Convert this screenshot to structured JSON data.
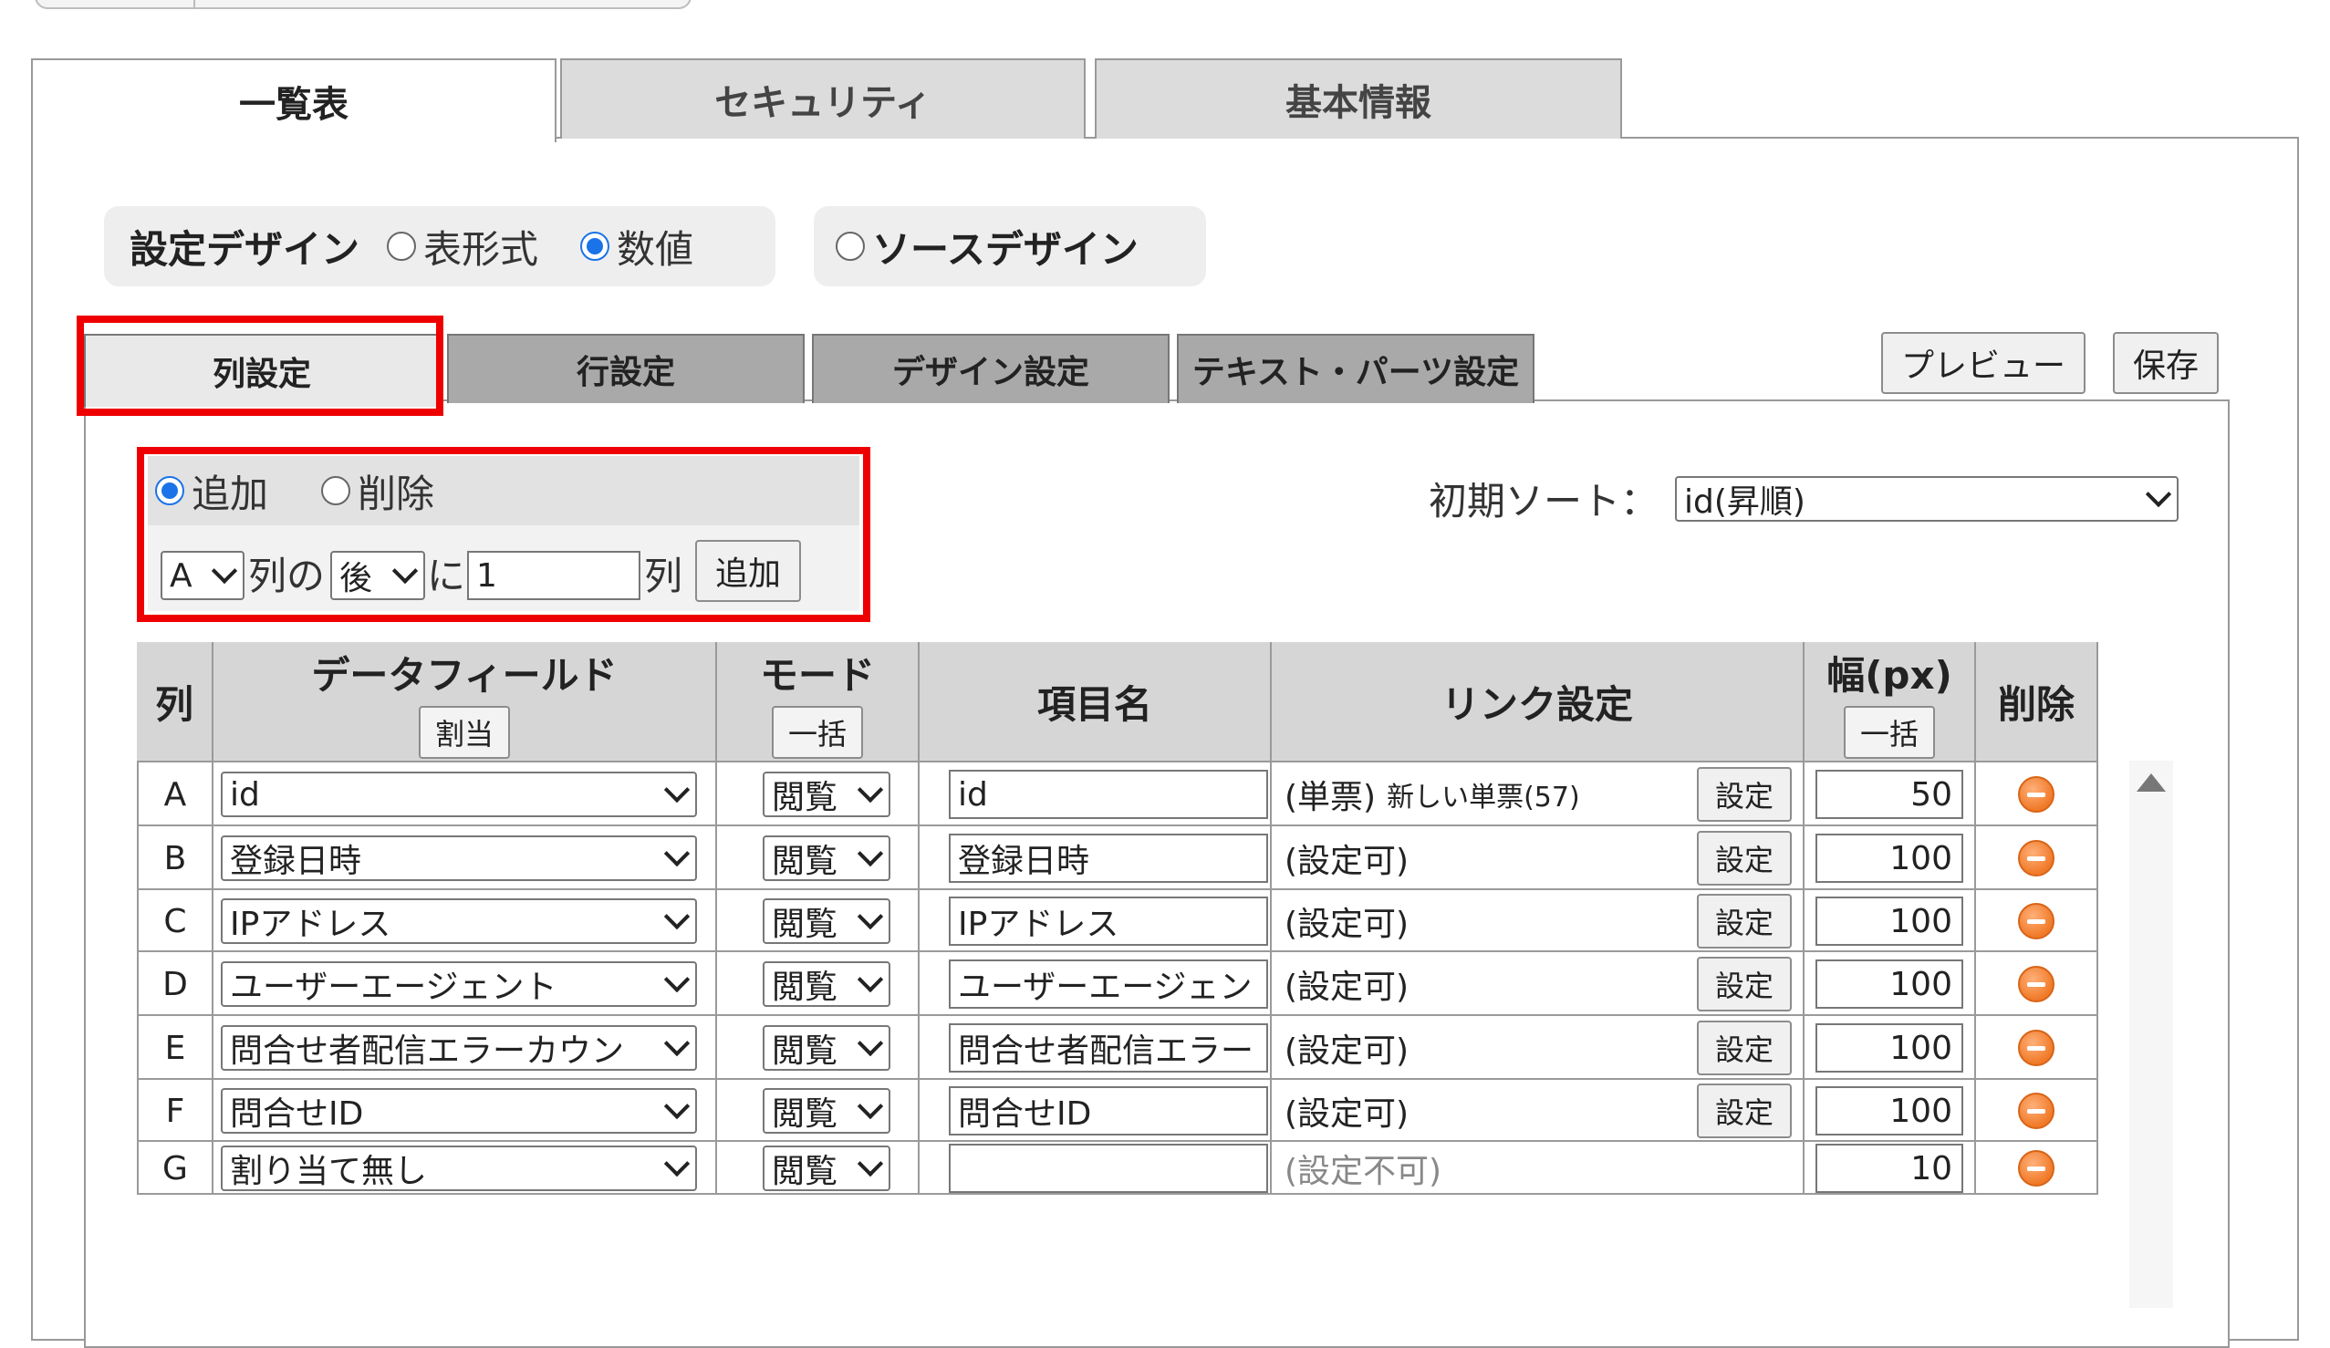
{
  "main_tabs": [
    {
      "label": "一覧表",
      "active": true
    },
    {
      "label": "セキュリティ",
      "active": false
    },
    {
      "label": "基本情報",
      "active": false
    }
  ],
  "design_mode": {
    "label": "設定デザイン",
    "options": [
      {
        "label": "表形式",
        "checked": false
      },
      {
        "label": "数値",
        "checked": true
      }
    ],
    "source_design": {
      "label": "ソースデザイン",
      "checked": false
    }
  },
  "sub_tabs": [
    {
      "label": "列設定",
      "active": true
    },
    {
      "label": "行設定",
      "active": false
    },
    {
      "label": "デザイン設定",
      "active": false
    },
    {
      "label": "テキスト・パーツ設定",
      "active": false
    }
  ],
  "toolbar": {
    "preview_label": "プレビュー",
    "save_label": "保存"
  },
  "column_ops": {
    "add_label": "追加",
    "delete_label": "削除",
    "add_checked": true,
    "column_select": "A",
    "column_suffix": "列の",
    "position_select": "後",
    "position_suffix": "に",
    "count_value": "1",
    "count_suffix": "列",
    "add_button_label": "追加"
  },
  "initial_sort": {
    "label": "初期ソート：",
    "value": "id(昇順)"
  },
  "table": {
    "headers": {
      "col": "列",
      "data_field": "データフィールド",
      "data_field_btn": "割当",
      "mode": "モード",
      "mode_btn": "一括",
      "item_name": "項目名",
      "link": "リンク設定",
      "width": "幅(px)",
      "width_btn": "一括",
      "delete": "削除"
    },
    "set_button_label": "設定",
    "rows": [
      {
        "col": "A",
        "field": "id",
        "mode": "閲覧",
        "item": "id",
        "link": "(単票)",
        "link_extra": "新しい単票(57)",
        "settable": true,
        "width": "50"
      },
      {
        "col": "B",
        "field": "登録日時",
        "mode": "閲覧",
        "item": "登録日時",
        "link": "(設定可)",
        "link_extra": "",
        "settable": true,
        "width": "100"
      },
      {
        "col": "C",
        "field": "IPアドレス",
        "mode": "閲覧",
        "item": "IPアドレス",
        "link": "(設定可)",
        "link_extra": "",
        "settable": true,
        "width": "100"
      },
      {
        "col": "D",
        "field": "ユーザーエージェント",
        "mode": "閲覧",
        "item": "ユーザーエージェン",
        "link": "(設定可)",
        "link_extra": "",
        "settable": true,
        "width": "100"
      },
      {
        "col": "E",
        "field": "問合せ者配信エラーカウン",
        "mode": "閲覧",
        "item": "問合せ者配信エラー",
        "link": "(設定可)",
        "link_extra": "",
        "settable": true,
        "width": "100"
      },
      {
        "col": "F",
        "field": "問合せID",
        "mode": "閲覧",
        "item": "問合せID",
        "link": "(設定可)",
        "link_extra": "",
        "settable": true,
        "width": "100"
      },
      {
        "col": "G",
        "field": "割り当て無し",
        "mode": "閲覧",
        "item": "",
        "link": "(設定不可)",
        "link_extra": "",
        "settable": false,
        "width": "10"
      }
    ]
  },
  "colors": {
    "highlight": "#ee0000",
    "radio_checked": "#1a73e8",
    "delete_icon": "#f07a28"
  }
}
